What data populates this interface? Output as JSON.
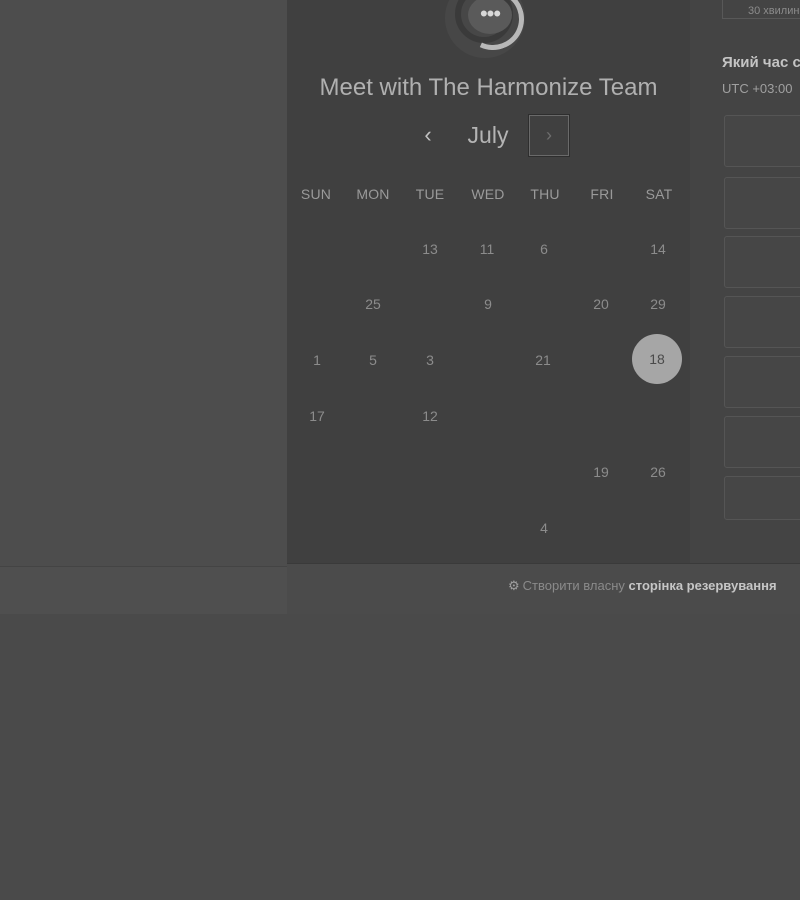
{
  "widget": {
    "title": "Meet with The Harmonize Team",
    "logo_icon": "chat-bubble-icon",
    "month": "July",
    "prev_icon": "‹",
    "next_icon": "›",
    "days_of_week": [
      "SUN",
      "MON",
      "TUE",
      "WED",
      "THU",
      "FRI",
      "SAT"
    ],
    "selected_day": "18",
    "days": [
      "13",
      "11",
      "6",
      "14",
      "25",
      "9",
      "20",
      "29",
      "1",
      "5",
      "3",
      "21",
      "18",
      "17",
      "12",
      "19",
      "26",
      "4"
    ]
  },
  "right_panel": {
    "duration": "30 хвилин",
    "time_question": "Який час с",
    "timezone": "UTC +03:00"
  },
  "footer": {
    "prefix": "Створити власну",
    "link": "сторінка резервування"
  }
}
